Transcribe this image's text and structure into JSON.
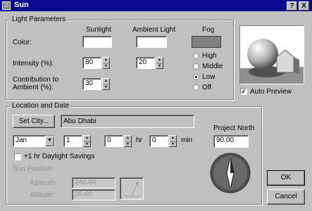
{
  "window": {
    "title": "Sun",
    "help_label": "?",
    "close_label": "X"
  },
  "light": {
    "group_title": "Light Parameters",
    "col_sunlight": "Sunlight",
    "col_ambient": "Ambient Light",
    "col_fog": "Fog",
    "color_label": "Color:",
    "intensity_label": "Intensity (%):",
    "contribution_label": "Contribution to\nAmbient (%):",
    "sun_intensity": "80",
    "ambient_intensity": "20",
    "contribution": "30",
    "colors": {
      "sunlight": "#ffffff",
      "ambient": "#ffffff",
      "fog": "#808080"
    },
    "fog_options": [
      "High",
      "Middle",
      "Low",
      "Off"
    ],
    "fog_selected": "Low"
  },
  "preview": {
    "auto_label": "Auto Preview",
    "auto_checked": true
  },
  "location": {
    "group_title": "Location and Date",
    "set_city_label": "Set City...",
    "city": "Abu Dhabi",
    "month": "Jan",
    "day": "1",
    "hour": "0",
    "hr_label": "hr",
    "minute": "0",
    "min_label": "min",
    "daylight_label": "+1 hr Daylight Savings",
    "daylight_checked": false,
    "sun_position_label": "Sun Position",
    "azimuth_label": "Azimuth:",
    "azimuth": "248.60",
    "altitude_label": "Altitude:",
    "altitude": "26.60",
    "project_north_label": "Project North",
    "project_north": "90.00"
  },
  "buttons": {
    "ok": "OK",
    "cancel": "Cancel"
  }
}
